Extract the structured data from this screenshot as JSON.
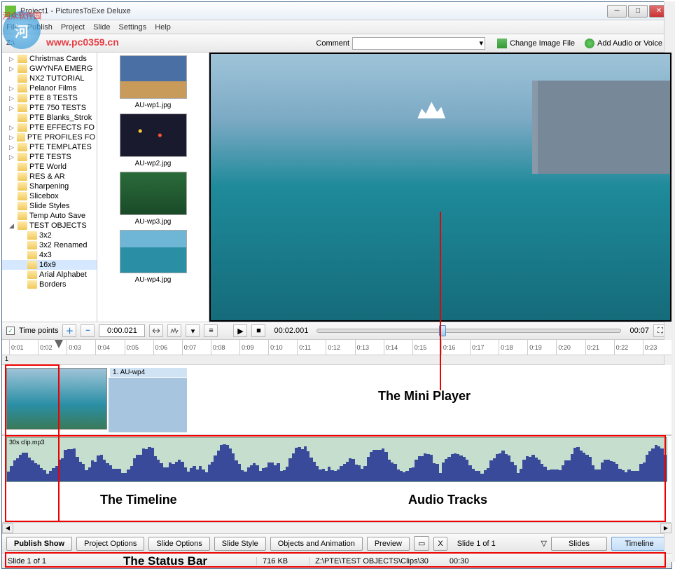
{
  "window": {
    "title": "Project1 - PicturesToExe Deluxe"
  },
  "menu": {
    "items": [
      "File",
      "Publish",
      "Project",
      "Slide",
      "Settings",
      "Help"
    ]
  },
  "watermark": {
    "text_cn": "河众软件园",
    "url": "www.pc0359.cn"
  },
  "toolbar": {
    "breadcrumb": "Z:\\",
    "comment_label": "Comment",
    "change_image": "Change Image File",
    "add_audio": "Add Audio or Voice"
  },
  "tree": {
    "items": [
      {
        "exp": "▷",
        "label": "Christmas Cards"
      },
      {
        "exp": "▷",
        "label": "GWYNFA EMERG"
      },
      {
        "exp": "",
        "label": "NX2 TUTORIAL"
      },
      {
        "exp": "▷",
        "label": "Pelanor Films"
      },
      {
        "exp": "▷",
        "label": "PTE 8 TESTS"
      },
      {
        "exp": "▷",
        "label": "PTE 750 TESTS"
      },
      {
        "exp": "",
        "label": "PTE Blanks_Strok"
      },
      {
        "exp": "▷",
        "label": "PTE EFFECTS FO"
      },
      {
        "exp": "▷",
        "label": "PTE PROFILES FO"
      },
      {
        "exp": "▷",
        "label": "PTE TEMPLATES"
      },
      {
        "exp": "▷",
        "label": "PTE TESTS"
      },
      {
        "exp": "",
        "label": "PTE World"
      },
      {
        "exp": "",
        "label": "RES & AR"
      },
      {
        "exp": "",
        "label": "Sharpening"
      },
      {
        "exp": "",
        "label": "Slicebox"
      },
      {
        "exp": "",
        "label": "Slide Styles"
      },
      {
        "exp": "",
        "label": "Temp Auto Save"
      },
      {
        "exp": "◢",
        "label": "TEST OBJECTS"
      },
      {
        "exp": "",
        "label": "3x2",
        "sub": true
      },
      {
        "exp": "",
        "label": "3x2 Renamed",
        "sub": true
      },
      {
        "exp": "",
        "label": "4x3",
        "sub": true
      },
      {
        "exp": "",
        "label": "16x9",
        "sub": true,
        "sel": true
      },
      {
        "exp": "",
        "label": "Arial Alphabet",
        "sub": true
      },
      {
        "exp": "",
        "label": "Borders",
        "sub": true
      }
    ]
  },
  "thumbs": [
    {
      "caption": "AU-wp1.jpg",
      "cls": "t1"
    },
    {
      "caption": "AU-wp2.jpg",
      "cls": "t2"
    },
    {
      "caption": "AU-wp3.jpg",
      "cls": "t3"
    },
    {
      "caption": "AU-wp4.jpg",
      "cls": "t4"
    }
  ],
  "timecontrols": {
    "timepoints_label": "Time points",
    "timepoints_checked": "✓",
    "current": "0:00.021",
    "play_time": "00:02.001",
    "duration": "00:07"
  },
  "ruler": {
    "ticks": [
      "0:01",
      "0:02",
      "0:03",
      "0:04",
      "0:05",
      "0:06",
      "0:07",
      "0:08",
      "0:09",
      "0:10",
      "0:11",
      "0:12",
      "0:13",
      "0:14",
      "0:15",
      "0:16",
      "0:17",
      "0:18",
      "0:19",
      "0:20",
      "0:21",
      "0:22",
      "0:23"
    ],
    "track_number": "1"
  },
  "slide_clip": {
    "label": "1. AU-wp4"
  },
  "audio_clip": {
    "name": "30s clip.mp3"
  },
  "annotations": {
    "mini_player": "The Mini Player",
    "timeline": "The Timeline",
    "audio_tracks": "Audio Tracks",
    "status_bar": "The Status Bar"
  },
  "bottombar": {
    "publish": "Publish Show",
    "project_options": "Project Options",
    "slide_options": "Slide Options",
    "slide_style": "Slide Style",
    "objects": "Objects and Animation",
    "preview": "Preview",
    "x": "X",
    "slide_of": "Slide 1 of 1",
    "slides_tab": "Slides",
    "timeline_tab": "Timeline"
  },
  "statusbar": {
    "slide": "Slide 1 of 1",
    "size": "716 KB",
    "path": "Z:\\PTE\\TEST OBJECTS\\Clips\\30",
    "dur": "00:30"
  }
}
